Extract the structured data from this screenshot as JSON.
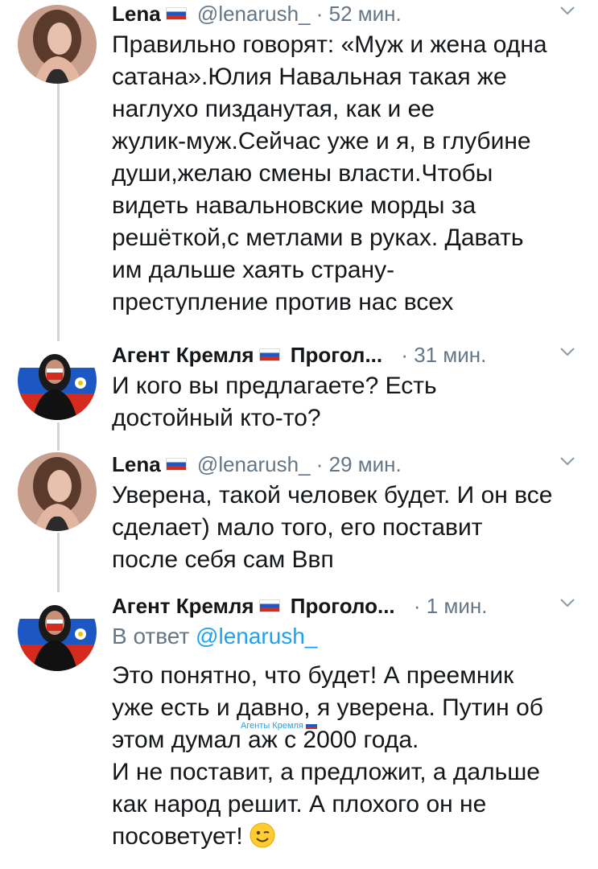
{
  "tweets": [
    {
      "name": "Lena",
      "handle": "@lenarush_",
      "time": "· 52 мин.",
      "text": "Правильно говорят: «Муж и жена одна\nсатана».Юлия Навальная такая же\nнаглухо пизданутая, как и ее\nжулик-муж.Сейчас уже и я, в глубине\nдуши,желаю смены власти.Чтобы\nвидеть навальновские морды за\nрешёткой,с метлами в руках. Давать\nим дальше хаять страну-\nпреступление против нас всех"
    },
    {
      "name": "Агент Кремля",
      "handle": "Прогол...",
      "time": "· 31 мин.",
      "text": "И кого вы предлагаете? Есть\nдостойный кто-то?"
    },
    {
      "name": "Lena",
      "handle": "@lenarush_",
      "time": "· 29 мин.",
      "text": "Уверена, такой человек будет. И он все\nсделает) мало того, его поставит\nпосле себя сам Ввп"
    },
    {
      "name": "Агент Кремля",
      "handle": "Проголо...",
      "time": "· 1 мин.",
      "reply_prefix": "В ответ",
      "reply_handle": "@lenarush_",
      "text": "Это понятно, что будет! А преемник\nуже есть и давно, я уверена. Путин об\nэтом думал аж с 2000 года.\nИ не поставит, а предложит, а дальше\nкак народ решит. А плохого он не\nпосоветует!"
    }
  ],
  "watermark": "Агенты Кремля",
  "icons": {
    "flag": "russian-flag-icon",
    "chevron": "chevron-down-icon",
    "emoji": "winking-face-icon"
  },
  "colors": {
    "secondary_text": "#657786",
    "link": "#1da1f2",
    "thread_line": "#cdd6dd"
  }
}
